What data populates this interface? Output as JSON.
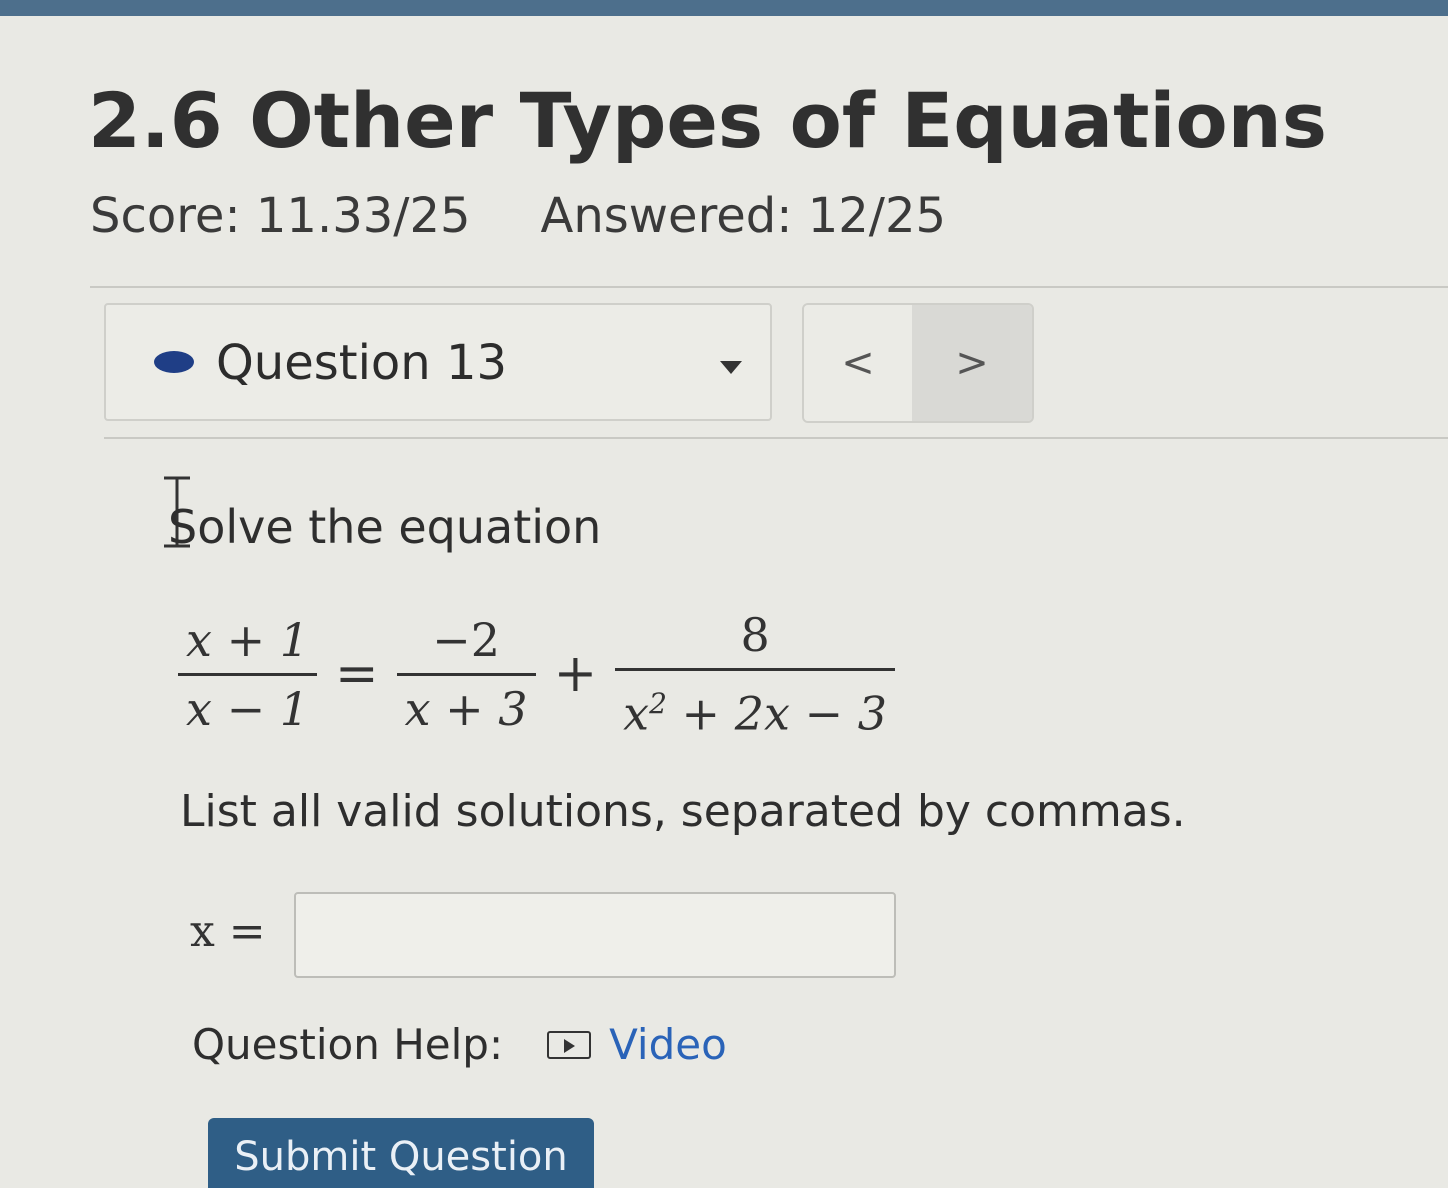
{
  "header": {
    "title": "2.6 Other Types of Equations",
    "score": "Score: 11.33/25",
    "answered": "Answered: 12/25"
  },
  "question_nav": {
    "selected": "Question 13",
    "prev_label": "<",
    "next_label": ">",
    "accent_color": "#1f3e86"
  },
  "question": {
    "prompt": "Solve the equation",
    "equation": {
      "lhs": {
        "numerator": "x + 1",
        "denominator": "x − 1"
      },
      "equals": "=",
      "term1": {
        "numerator": "−2",
        "denominator": "x + 3"
      },
      "plus": "+",
      "term2": {
        "numerator": "8",
        "denominator_base": "x",
        "denominator_exp": "2",
        "denominator_rest": " + 2x − 3"
      }
    },
    "instructions": "List all valid solutions, separated by commas.",
    "answer_label": "x =",
    "answer_value": ""
  },
  "help": {
    "label": "Question Help:",
    "video_label": "Video",
    "link_color": "#2a63b8"
  },
  "submit": {
    "label": "Submit Question",
    "color": "#2f5e86"
  }
}
